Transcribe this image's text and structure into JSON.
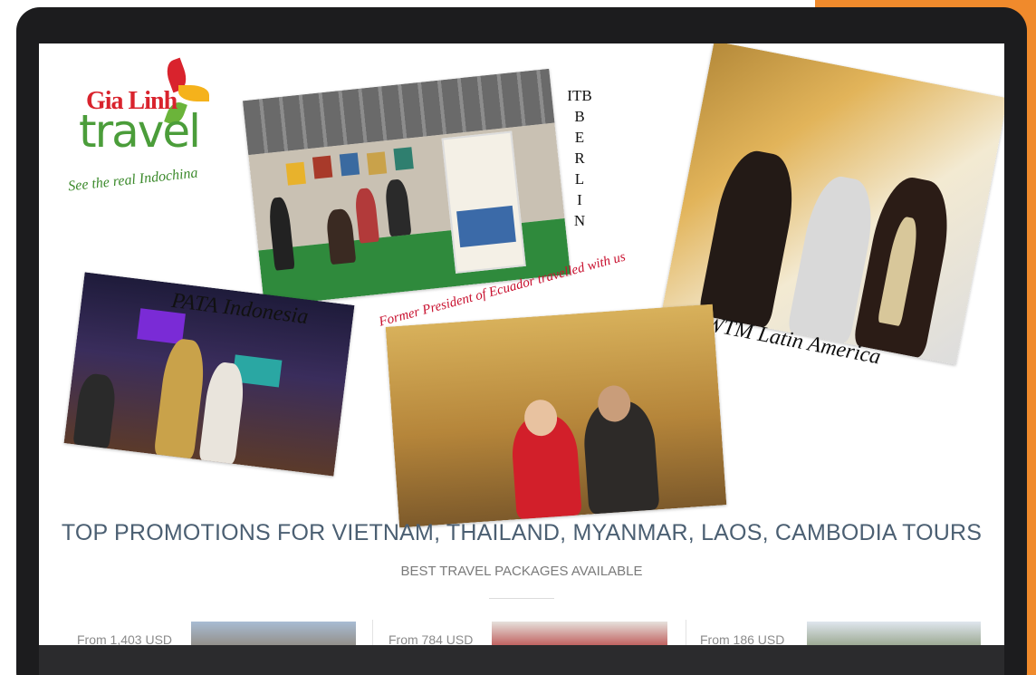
{
  "colors": {
    "accent": "#f08a2c",
    "brand_red": "#d9232d",
    "brand_green": "#4b9d3a",
    "heading": "#4b5f72"
  },
  "logo": {
    "brand_top": "Gia Linh",
    "brand_bottom": "travel",
    "tagline": "See the real Indochina"
  },
  "collage": {
    "itb_caption_lines": [
      "ITB",
      "B",
      "E",
      "R",
      "L",
      "I",
      "N"
    ],
    "wtm_caption": "WTM Latin America",
    "pata_caption": "PATA Indonesia",
    "ecuador_caption": "Former President of Ecuador travelled with us"
  },
  "promo": {
    "title": "TOP PROMOTIONS FOR VIETNAM, THAILAND, MYANMAR, LAOS, CAMBODIA TOURS",
    "subtitle": "BEST TRAVEL PACKAGES AVAILABLE",
    "cards": [
      {
        "price_label": "From 1,403 USD"
      },
      {
        "price_label": "From 784 USD"
      },
      {
        "price_label": "From 186 USD"
      }
    ]
  }
}
